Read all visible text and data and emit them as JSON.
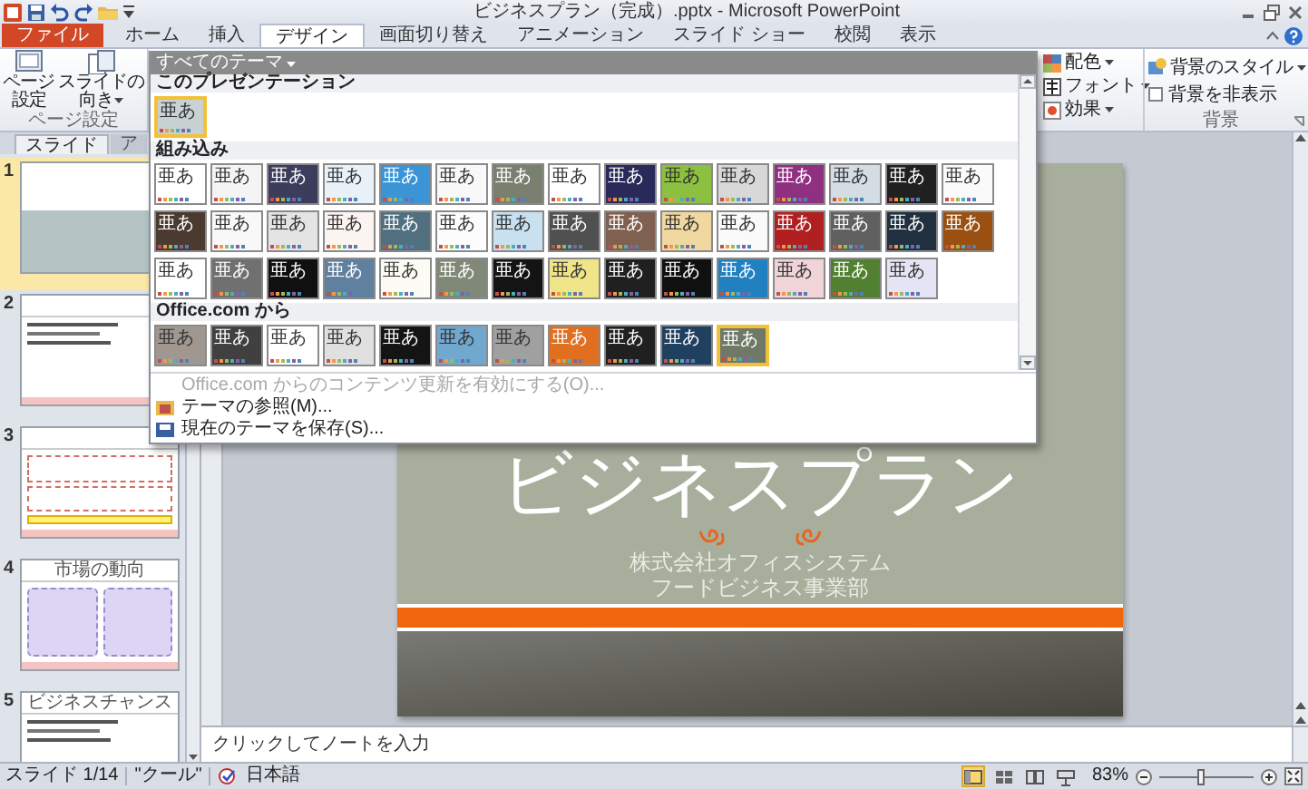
{
  "window": {
    "title": "ビジネスプラン（完成）.pptx - Microsoft PowerPoint"
  },
  "ribbon_tabs": [
    {
      "label": "ファイル",
      "kind": "file",
      "selected": false
    },
    {
      "label": "ホーム",
      "kind": "tab",
      "selected": false
    },
    {
      "label": "挿入",
      "kind": "tab",
      "selected": false
    },
    {
      "label": "デザイン",
      "kind": "tab",
      "selected": true
    },
    {
      "label": "画面切り替え",
      "kind": "tab",
      "selected": false
    },
    {
      "label": "アニメーション",
      "kind": "tab",
      "selected": false
    },
    {
      "label": "スライド ショー",
      "kind": "tab",
      "selected": false
    },
    {
      "label": "校閲",
      "kind": "tab",
      "selected": false
    },
    {
      "label": "表示",
      "kind": "tab",
      "selected": false
    }
  ],
  "page_setup_group": {
    "buttons": [
      {
        "label": "ページ設定",
        "kind": "page"
      },
      {
        "label": "スライドの向き",
        "kind": "orientation"
      }
    ],
    "label": "ページ設定"
  },
  "theme_commands": [
    {
      "label": "配色",
      "kind": "colors"
    },
    {
      "label": "フォント",
      "kind": "fonts"
    },
    {
      "label": "効果",
      "kind": "effects"
    }
  ],
  "background_group": {
    "style_button": "背景のスタイル",
    "hide_graphics": {
      "label": "背景を非表示",
      "checked": false
    },
    "label": "背景"
  },
  "theme_gallery": {
    "filter": "すべてのテーマ",
    "sections": [
      {
        "title": "このプレゼンテーション",
        "themes": [
          {
            "sample": "亜あ",
            "color": "#c8d2d2",
            "selected": true
          }
        ]
      },
      {
        "title": "組み込み",
        "themes": [
          {
            "sample": "亜あ",
            "color": "#ffffff",
            "selected": false
          },
          {
            "sample": "亜あ",
            "color": "#f4f4f4",
            "selected": false
          },
          {
            "sample": "亜あ",
            "color": "#3c3c5c",
            "selected": false
          },
          {
            "sample": "亜あ",
            "color": "#e8f2f8",
            "selected": false
          },
          {
            "sample": "亜あ",
            "color": "#3a94d6",
            "selected": false
          },
          {
            "sample": "亜あ",
            "color": "#f8f8f8",
            "selected": false
          },
          {
            "sample": "亜あ",
            "color": "#7a8070",
            "selected": false
          },
          {
            "sample": "亜あ",
            "color": "#ffffff",
            "selected": false
          },
          {
            "sample": "亜あ",
            "color": "#2a2a5a",
            "selected": false
          },
          {
            "sample": "亜あ",
            "color": "#8cc040",
            "selected": false
          },
          {
            "sample": "亜あ",
            "color": "#d8d8d8",
            "selected": false
          },
          {
            "sample": "亜あ",
            "color": "#903080",
            "selected": false
          },
          {
            "sample": "亜あ",
            "color": "#d4dce4",
            "selected": false
          },
          {
            "sample": "亜あ",
            "color": "#202020",
            "selected": false
          },
          {
            "sample": "亜あ",
            "color": "#fafafa",
            "selected": false
          },
          {
            "sample": "亜あ",
            "color": "#4a3a30",
            "selected": false
          },
          {
            "sample": "亜あ",
            "color": "#f8f8f8",
            "selected": false
          },
          {
            "sample": "亜あ",
            "color": "#e4e4e4",
            "selected": false
          },
          {
            "sample": "亜あ",
            "color": "#fcf4f0",
            "selected": false
          },
          {
            "sample": "亜あ",
            "color": "#507080",
            "selected": false
          },
          {
            "sample": "亜あ",
            "color": "#fcfcfc",
            "selected": false
          },
          {
            "sample": "亜あ",
            "color": "#c8e0f0",
            "selected": false
          },
          {
            "sample": "亜あ",
            "color": "#505050",
            "selected": false
          },
          {
            "sample": "亜あ",
            "color": "#806050",
            "selected": false
          },
          {
            "sample": "亜あ",
            "color": "#f0d8a0",
            "selected": false
          },
          {
            "sample": "亜あ",
            "color": "#fafafa",
            "selected": false
          },
          {
            "sample": "亜あ",
            "color": "#b02020",
            "selected": false
          },
          {
            "sample": "亜あ",
            "color": "#606060",
            "selected": false
          },
          {
            "sample": "亜あ",
            "color": "#203040",
            "selected": false
          },
          {
            "sample": "亜あ",
            "color": "#9a5010",
            "selected": false
          },
          {
            "sample": "亜あ",
            "color": "#ffffff",
            "selected": false
          },
          {
            "sample": "亜あ",
            "color": "#707070",
            "selected": false
          },
          {
            "sample": "亜あ",
            "color": "#101010",
            "selected": false
          },
          {
            "sample": "亜あ",
            "color": "#6080a0",
            "selected": false
          },
          {
            "sample": "亜あ",
            "color": "#fcfcf4",
            "selected": false
          },
          {
            "sample": "亜あ",
            "color": "#808878",
            "selected": false
          },
          {
            "sample": "亜あ",
            "color": "#141414",
            "selected": false
          },
          {
            "sample": "亜あ",
            "color": "#f0e488",
            "selected": false
          },
          {
            "sample": "亜あ",
            "color": "#202020",
            "selected": false
          },
          {
            "sample": "亜あ",
            "color": "#101010",
            "selected": false
          },
          {
            "sample": "亜あ",
            "color": "#2080c0",
            "selected": false
          },
          {
            "sample": "亜あ",
            "color": "#f0d4d8",
            "selected": false
          },
          {
            "sample": "亜あ",
            "color": "#508030",
            "selected": false
          },
          {
            "sample": "亜あ",
            "color": "#e4e4f4",
            "selected": false
          }
        ]
      },
      {
        "title": "Office.com から",
        "themes": [
          {
            "sample": "亜あ",
            "color": "#a09890",
            "selected": false
          },
          {
            "sample": "亜あ",
            "color": "#404040",
            "selected": false
          },
          {
            "sample": "亜あ",
            "color": "#ffffff",
            "selected": false
          },
          {
            "sample": "亜あ",
            "color": "#e0e0e0",
            "selected": false
          },
          {
            "sample": "亜あ",
            "color": "#141414",
            "selected": false
          },
          {
            "sample": "亜あ",
            "color": "#70a8d0",
            "selected": false
          },
          {
            "sample": "亜あ",
            "color": "#a0a0a0",
            "selected": false
          },
          {
            "sample": "亜あ",
            "color": "#e07020",
            "selected": false
          },
          {
            "sample": "亜あ",
            "color": "#202020",
            "selected": false
          },
          {
            "sample": "亜あ",
            "color": "#204060",
            "selected": false
          },
          {
            "sample": "亜あ",
            "color": "#707868",
            "selected": true
          }
        ]
      }
    ],
    "menu": [
      {
        "label": "Office.com からのコンテンツ更新を有効にする(O)...",
        "kind": "update",
        "disabled": true
      },
      {
        "label": "テーマの参照(M)...",
        "kind": "browse",
        "disabled": false
      },
      {
        "label": "現在のテーマを保存(S)...",
        "kind": "save",
        "disabled": false
      }
    ]
  },
  "panel_tabs": [
    {
      "label": "スライド",
      "selected": true
    },
    {
      "label": "ア",
      "selected": false
    }
  ],
  "slides": [
    {
      "number": "1",
      "selected": true,
      "kind": "title"
    },
    {
      "number": "2",
      "selected": false,
      "kind": "bullets"
    },
    {
      "number": "3",
      "selected": false,
      "kind": "boxes"
    },
    {
      "number": "4",
      "selected": false,
      "kind": "columns",
      "title": "市場の動向"
    },
    {
      "number": "5",
      "selected": false,
      "kind": "bullets",
      "title": "ビジネスチャンス"
    }
  ],
  "slide": {
    "title": "ビジネスプラン",
    "company": "株式会社オフィスシステム",
    "department": "フードビジネス事業部"
  },
  "notes": {
    "placeholder": "クリックしてノートを入力"
  },
  "status_bar": {
    "slide": "スライド 1/14",
    "theme": "\"クール\"",
    "language": "日本語",
    "views": [
      {
        "kind": "normal",
        "selected": true
      },
      {
        "kind": "sorter",
        "selected": false
      },
      {
        "kind": "reading",
        "selected": false
      },
      {
        "kind": "slideshow",
        "selected": false
      }
    ],
    "zoom": {
      "reading": "83%",
      "level": 0.45
    }
  }
}
